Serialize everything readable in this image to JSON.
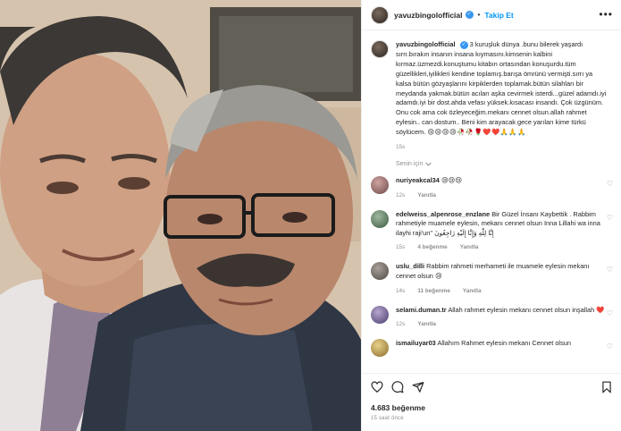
{
  "post": {
    "username": "yavuzbingolofficial",
    "follow_label": "Takip Et",
    "more_label": "•••",
    "dot": "•",
    "verified_glyph": "✓"
  },
  "caption": {
    "username": "yavuzbingolofficial",
    "text": "3 kuruşluk dünya .bunu bilerek yaşardı sırrı.bırakın insanın insana kıymasını.kimsenin kalbini kırmaz.üzmezdi.konuştumu kitabın ortasından konuşurdu.tüm güzellikleri,iyilikleri kendine toplamış.barışa ömrünü vermişti.sırrı ya kalsa bütün gözyaşlarını kirpiklerden toplamak.bütün silahları bir meydanda yakmak.bütün acıları aşka cevirmek isterdi...güzel adamdı.iyi adamdı.iyi bir dost.ahda vefası yüksek.kısacası insandı. Çok üzgünüm. Onu cok ama cok özleyeceğim.mekanı cennet olsun.allah rahmet eylesin.. can dostum.. Beni kim arayacak gece yarıları kime türkü söylücem.",
    "emojis": "😢😢😢😢🥀🥀🌹❤️❤️🙏🙏🙏",
    "time": "15s"
  },
  "for_you_label": "Senin için",
  "comments": [
    {
      "username": "nuriyeakcal34",
      "text": "😢😢😢",
      "time": "12s",
      "likes": "",
      "reply": "Yanıtla"
    },
    {
      "username": "edelweiss_alpenrose_enzlane",
      "text": "Bir Güzel İnsanı Kaybettik . Rabbim rahmetiyle muamele eylesin, mekanı cennet olsun Inna Lillahi wa inna ilayhi raji'un\" إِنَّا لِلّٰهِ وَإِنَّا إِلَيْهِ رَاجِعُونَ",
      "time": "15s",
      "likes": "4 beğenme",
      "reply": "Yanıtla"
    },
    {
      "username": "uslu_dilli",
      "text": "Rabbim rahmeti merhameti ile muamele eylesin mekanı cennet olsun 😢",
      "time": "14s",
      "likes": "11 beğenme",
      "reply": "Yanıtla"
    },
    {
      "username": "selami.duman.tr",
      "text": "Allah rahmet eylesin mekanı cennet olsun inşallah ❤️",
      "time": "12s",
      "likes": "",
      "reply": "Yanıtla"
    },
    {
      "username": "ismailuyar03",
      "text": "Allahım Rahmet eylesin mekanı Cennet olsun",
      "time": "",
      "likes": "",
      "reply": ""
    }
  ],
  "footer": {
    "likes": "4.683 beğenme",
    "time": "15 saat önce"
  },
  "icons": [
    "heart-icon",
    "comment-icon",
    "share-icon",
    "bookmark-icon",
    "chevron-down-icon",
    "more-icon"
  ],
  "colors": {
    "accent": "#0095f6",
    "verified": "#3897f0",
    "muted": "#8e8e8e",
    "text": "#262626"
  }
}
